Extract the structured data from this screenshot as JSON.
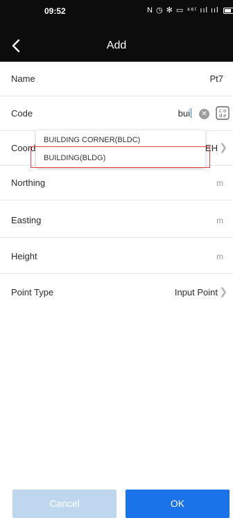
{
  "status_bar": {
    "time": "09:52",
    "icons_text": "N ◷ ✻ ▭ ⁴⁶⁽ ııl ııl"
  },
  "header": {
    "title": "Add"
  },
  "form": {
    "name": {
      "label": "Name",
      "value": "Pt7"
    },
    "code": {
      "label": "Code",
      "value": "bui"
    },
    "coordinate": {
      "label": "Coordinate",
      "value": "NEH"
    },
    "northing": {
      "label": "Northing",
      "unit": "m"
    },
    "easting": {
      "label": "Easting",
      "unit": "m"
    },
    "height": {
      "label": "Height",
      "unit": "m"
    },
    "point_type": {
      "label": "Point Type",
      "value": "Input Point"
    }
  },
  "code_suggestions": [
    "BUILDING CORNER(BLDC)",
    "BUILDING(BLDG)"
  ],
  "buttons": {
    "cancel": "Cancel",
    "ok": "OK"
  },
  "colors": {
    "primary": "#1a73e8",
    "cancel_disabled": "#bfd6ef",
    "highlight": "#e04040",
    "bar": "#0c0c0c"
  },
  "icons": {
    "back": "chevron-left-icon",
    "clear": "clear-icon",
    "code_lib": "code-library-icon",
    "chevron": "chevron-right-icon"
  }
}
